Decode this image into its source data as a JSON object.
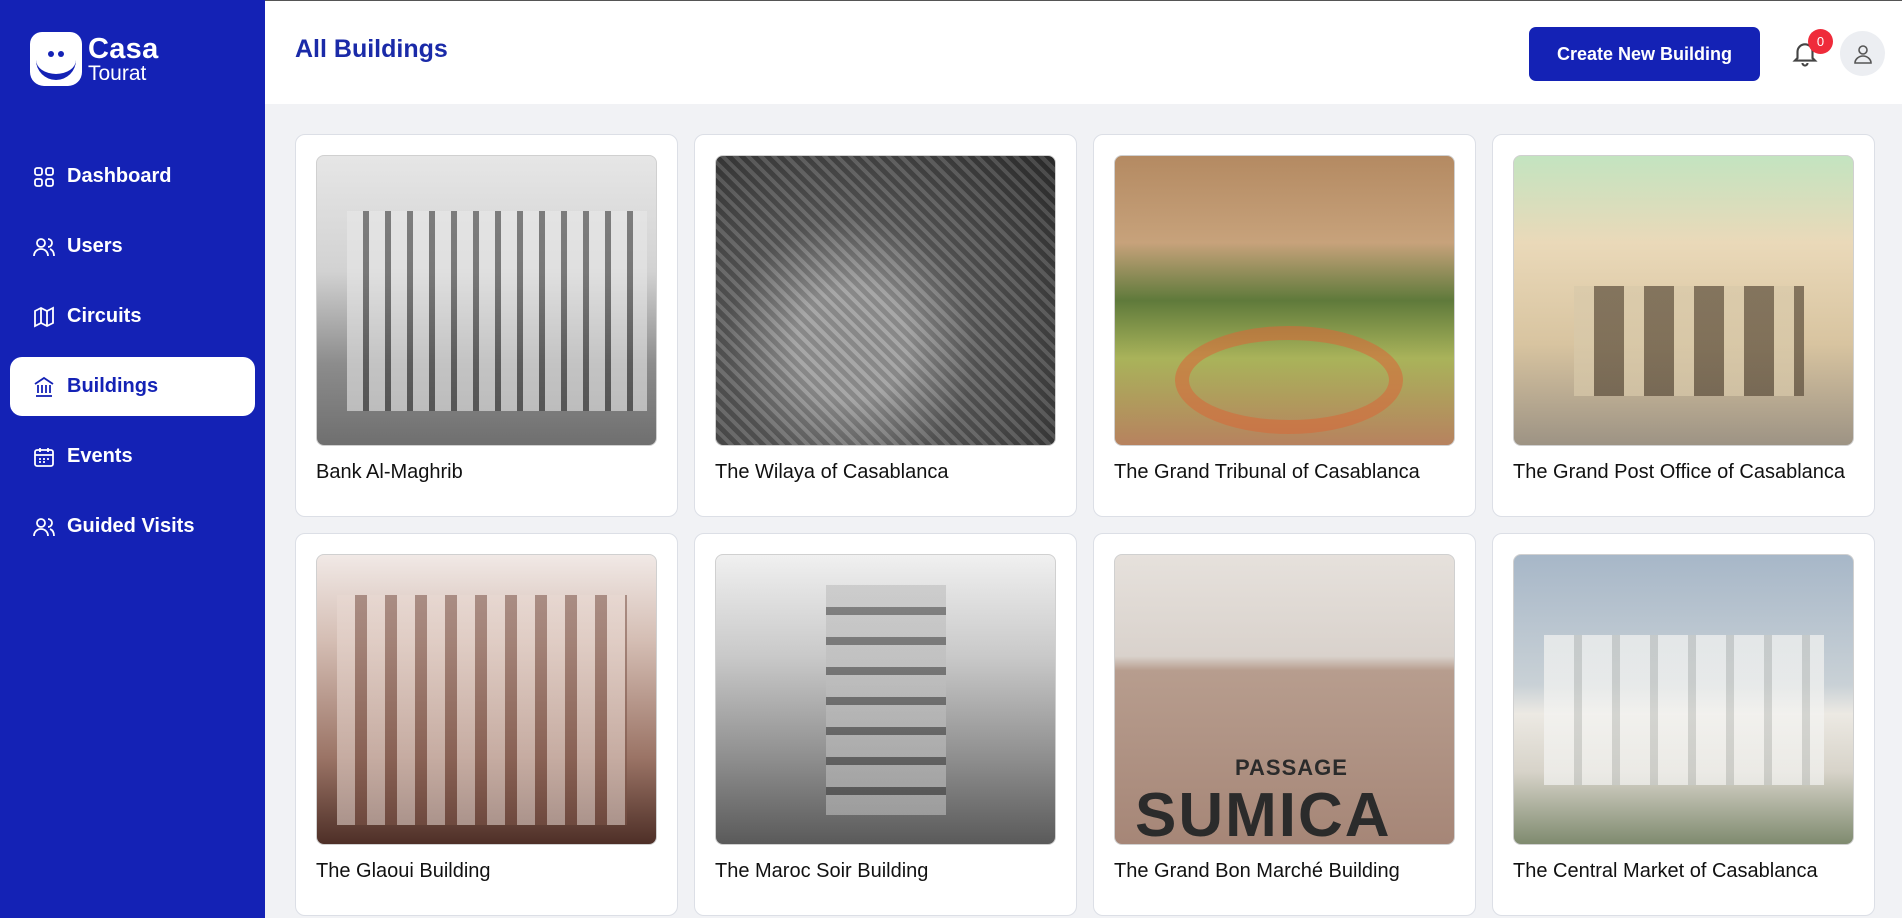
{
  "app": {
    "logo_line1": "Casa",
    "logo_line2": "Tourat",
    "accent_color": "#1422b5"
  },
  "sidebar": {
    "items": [
      {
        "label": "Dashboard",
        "icon": "dashboard-grid-icon",
        "active": false
      },
      {
        "label": "Users",
        "icon": "users-icon",
        "active": false
      },
      {
        "label": "Circuits",
        "icon": "map-icon",
        "active": false
      },
      {
        "label": "Buildings",
        "icon": "building-icon",
        "active": true
      },
      {
        "label": "Events",
        "icon": "calendar-icon",
        "active": false
      },
      {
        "label": "Guided Visits",
        "icon": "group-icon",
        "active": false
      }
    ]
  },
  "header": {
    "title": "All Buildings",
    "create_button": "Create New Building",
    "notification_count": "0"
  },
  "buildings": [
    {
      "name": "Bank Al-Maghrib",
      "image": "bank-photo"
    },
    {
      "name": "The Wilaya of Casablanca",
      "image": "wilaya-photo"
    },
    {
      "name": "The Grand Tribunal of Casablanca",
      "image": "tribunal-photo"
    },
    {
      "name": "The Grand Post Office of Casablanca",
      "image": "post-office-photo"
    },
    {
      "name": "The Glaoui Building",
      "image": "glaoui-photo"
    },
    {
      "name": "The Maroc Soir Building",
      "image": "maroc-soir-photo"
    },
    {
      "name": "The Grand Bon Marché Building",
      "image": "bon-marche-photo"
    },
    {
      "name": "The Central Market of Casablanca",
      "image": "central-market-photo"
    }
  ],
  "photo_text": {
    "sumica_line1": "PASSAGE",
    "sumica_line2": "SUMICA"
  }
}
